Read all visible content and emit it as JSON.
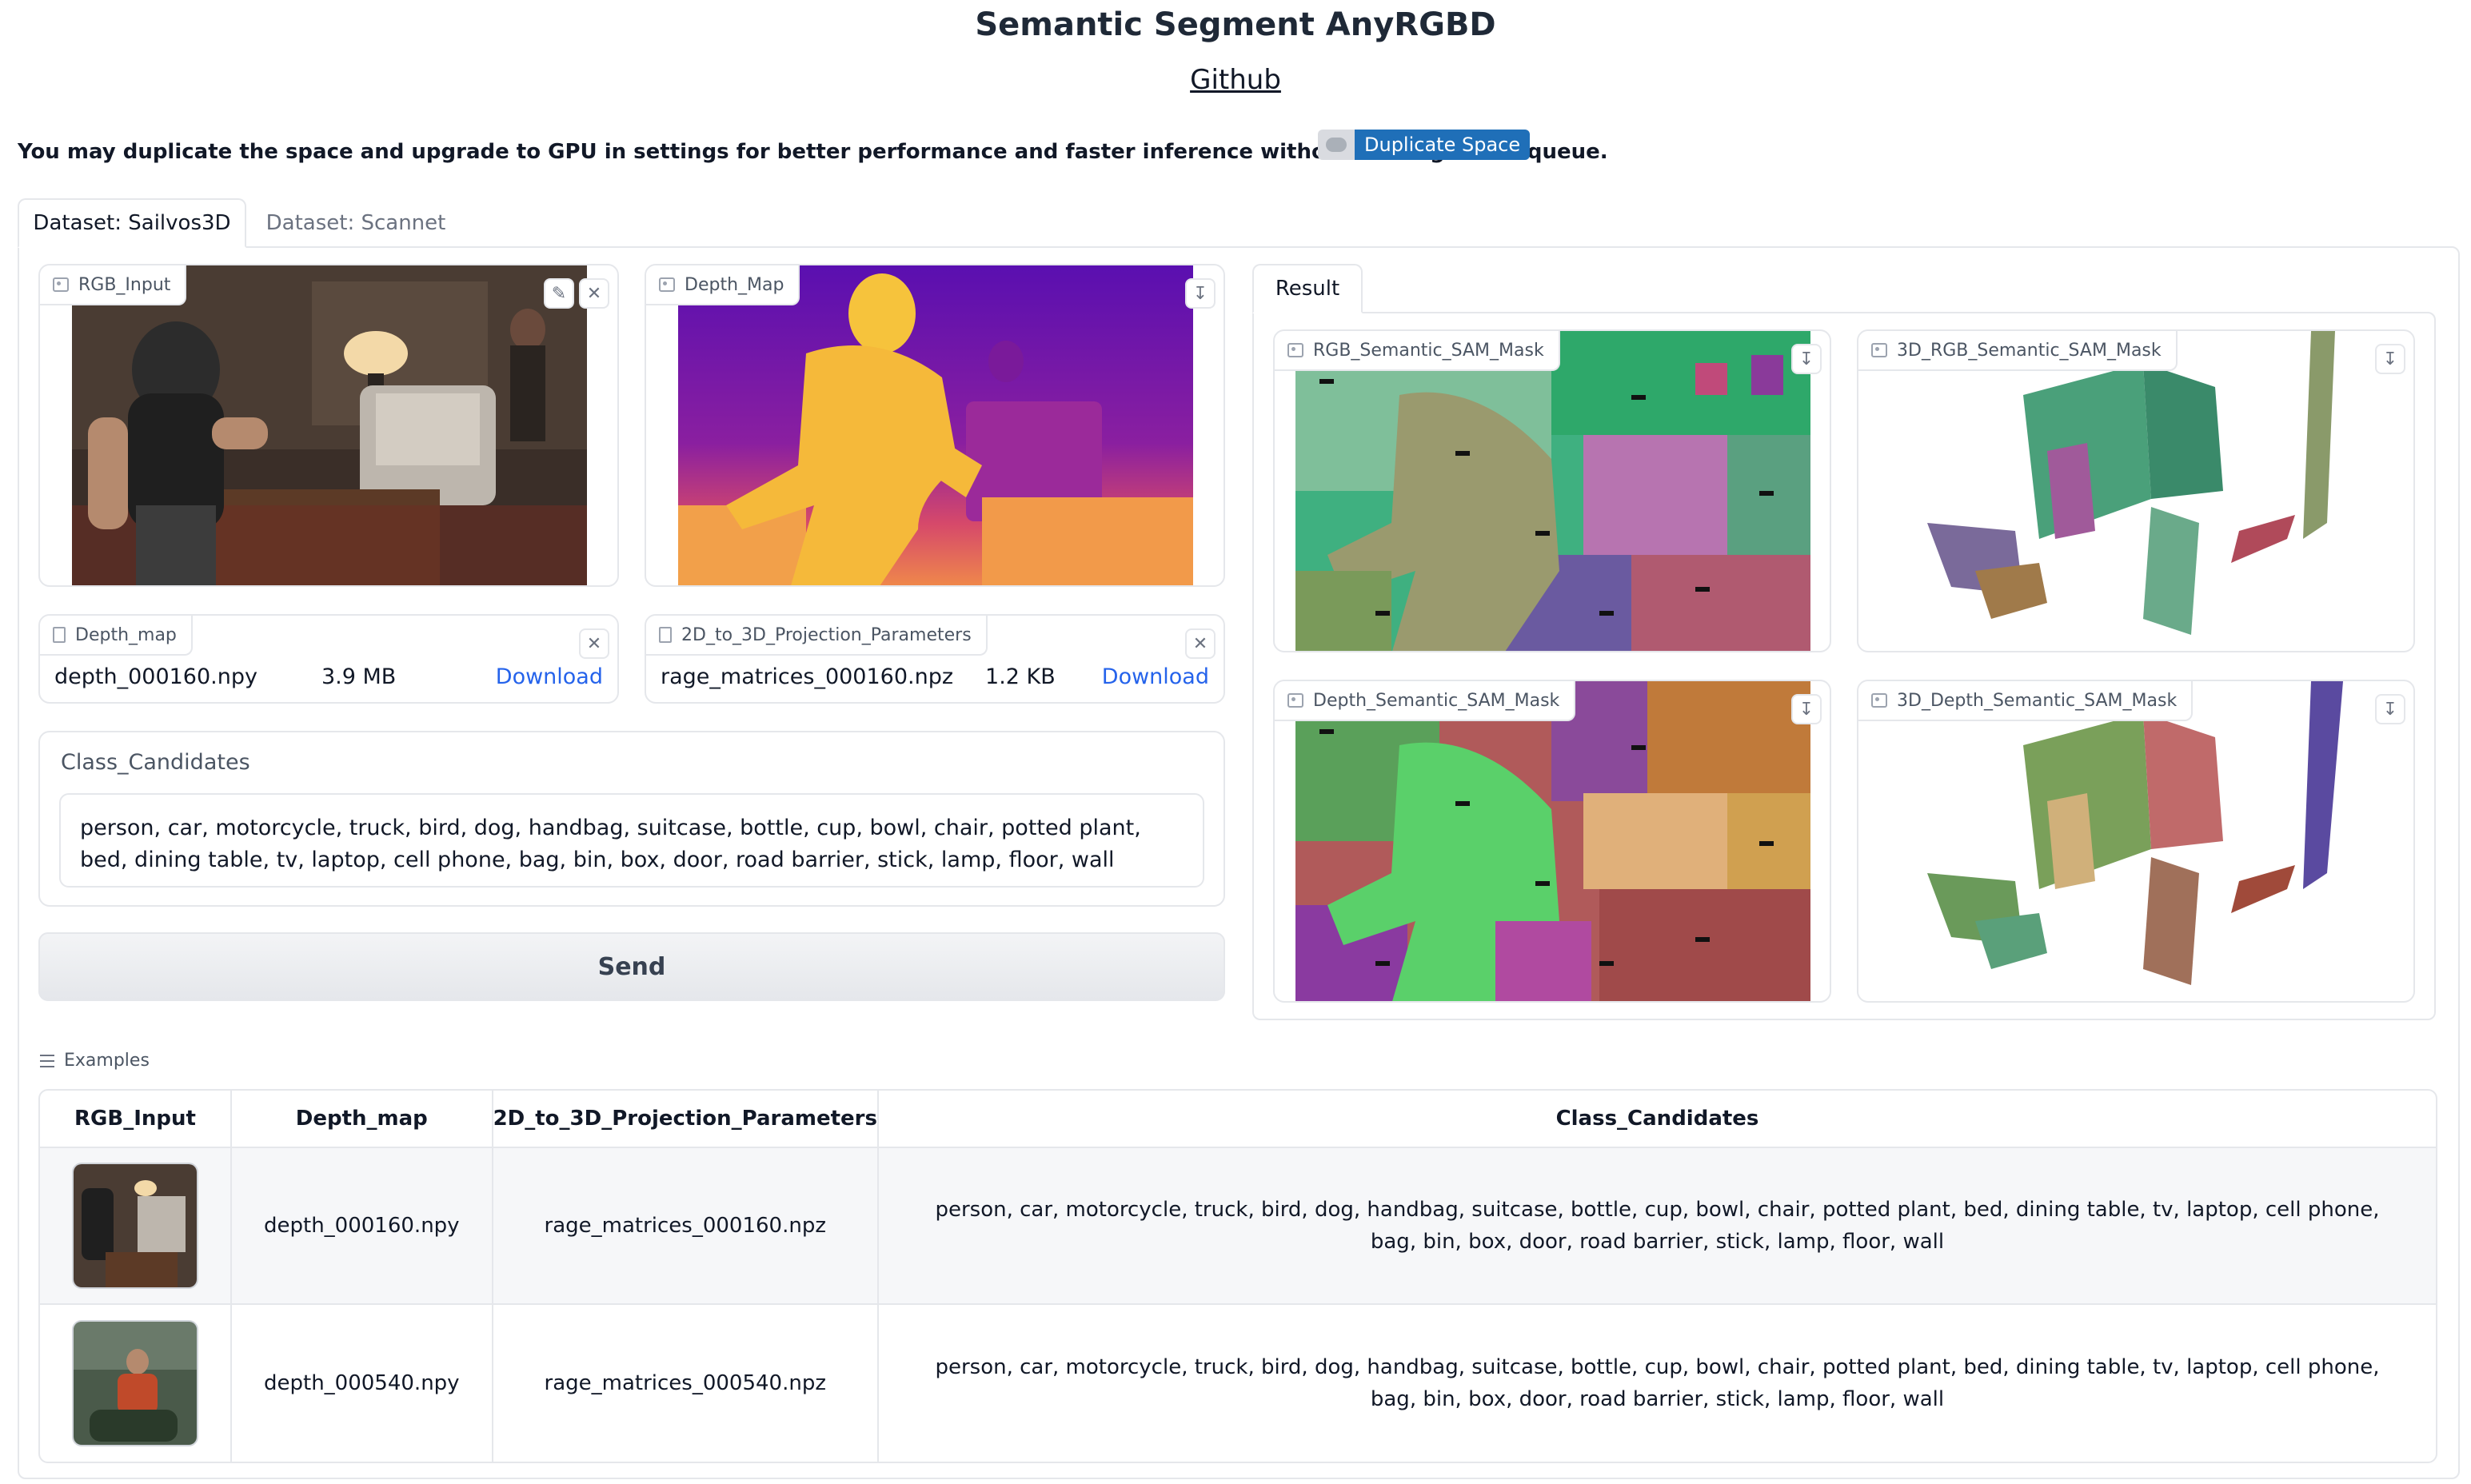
{
  "header": {
    "title": "Semantic Segment AnyRGBD",
    "github_link": "Github",
    "notice": "You may duplicate the space and upgrade to GPU in settings for better performance and faster inference without waiting in the queue.",
    "duplicate_button": "Duplicate Space"
  },
  "tabs": [
    {
      "label": "Dataset: Sailvos3D",
      "active": true
    },
    {
      "label": "Dataset: Scannet",
      "active": false
    }
  ],
  "inputs": {
    "rgb_label": "RGB_Input",
    "depth_map_image_label": "Depth_Map",
    "depth_file": {
      "label": "Depth_map",
      "name": "depth_000160.npy",
      "size": "3.9 MB",
      "download": "Download"
    },
    "projection_file": {
      "label": "2D_to_3D_Projection_Parameters",
      "name": "rage_matrices_000160.npz",
      "size": "1.2 KB",
      "download": "Download"
    },
    "class_candidates_label": "Class_Candidates",
    "class_candidates_value": "person, car, motorcycle, truck, bird, dog, handbag, suitcase, bottle, cup, bowl, chair, potted plant, bed, dining table, tv, laptop, cell phone, bag, bin, box, door, road barrier, stick, lamp, floor, wall",
    "send_button": "Send"
  },
  "result": {
    "tab_label": "Result",
    "outputs": [
      {
        "label": "RGB_Semantic_SAM_Mask"
      },
      {
        "label": "3D_RGB_Semantic_SAM_Mask"
      },
      {
        "label": "Depth_Semantic_SAM_Mask"
      },
      {
        "label": "3D_Depth_Semantic_SAM_Mask"
      }
    ]
  },
  "examples": {
    "label": "Examples",
    "headers": [
      "RGB_Input",
      "Depth_map",
      "2D_to_3D_Projection_Parameters",
      "Class_Candidates"
    ],
    "rows": [
      {
        "depth": "depth_000160.npy",
        "params": "rage_matrices_000160.npz",
        "classes": "person, car, motorcycle, truck, bird, dog, handbag, suitcase, bottle, cup, bowl, chair, potted plant, bed, dining table, tv, laptop, cell phone, bag, bin, box, door, road barrier, stick, lamp, floor, wall"
      },
      {
        "depth": "depth_000540.npy",
        "params": "rage_matrices_000540.npz",
        "classes": "person, car, motorcycle, truck, bird, dog, handbag, suitcase, bottle, cup, bowl, chair, potted plant, bed, dining table, tv, laptop, cell phone, bag, bin, box, door, road barrier, stick, lamp, floor, wall"
      }
    ]
  },
  "icons": {
    "edit": "pencil-icon",
    "clear": "close-icon",
    "download": "download-icon",
    "image": "image-icon",
    "file": "file-icon",
    "examples": "list-icon"
  }
}
